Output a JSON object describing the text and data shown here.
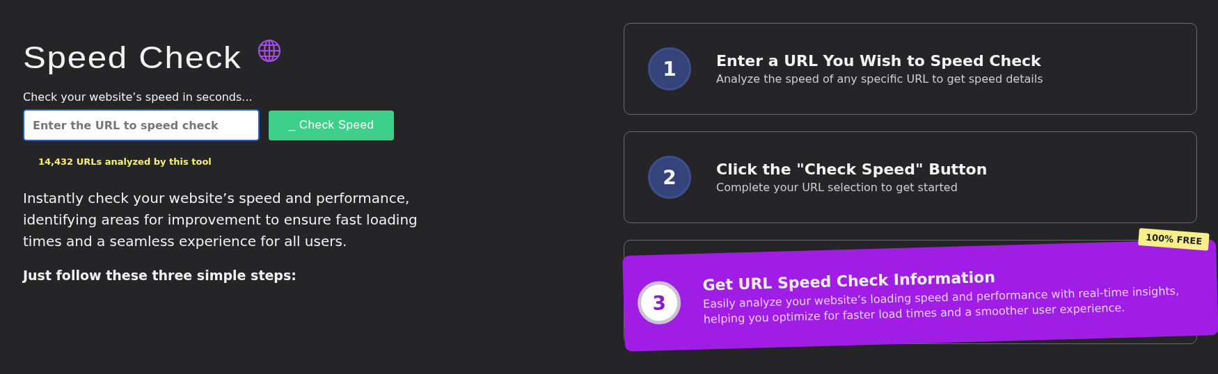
{
  "hero": {
    "title": "Speed Check",
    "subtitle": "Check your website’s speed in seconds...",
    "url_field": {
      "placeholder": "Enter the URL to speed check",
      "focused": true
    },
    "check_button": "_ Check Speed",
    "counter": "14,432 URLs analyzed by this tool",
    "description": "Instantly check your website’s speed and performance, identifying areas for improvement to ensure fast loading times and a seamless experience for all users.",
    "steps_heading": "Just follow these three simple steps:"
  },
  "steps": [
    {
      "number": "1",
      "title": "Enter a URL You Wish to Speed Check",
      "text": "Analyze the speed of any specific URL to get speed details",
      "highlighted": false
    },
    {
      "number": "2",
      "title": "Click the \"Check Speed\" Button",
      "text": "Complete your URL selection to get started",
      "highlighted": false
    },
    {
      "number": "3",
      "title": "Get URL Speed Check Information",
      "text": "Easily analyze your website’s loading speed and performance with real-time insights, helping you optimize for faster load times and a smoother user experience.",
      "highlighted": true,
      "badge": "100% FREE"
    }
  ]
}
